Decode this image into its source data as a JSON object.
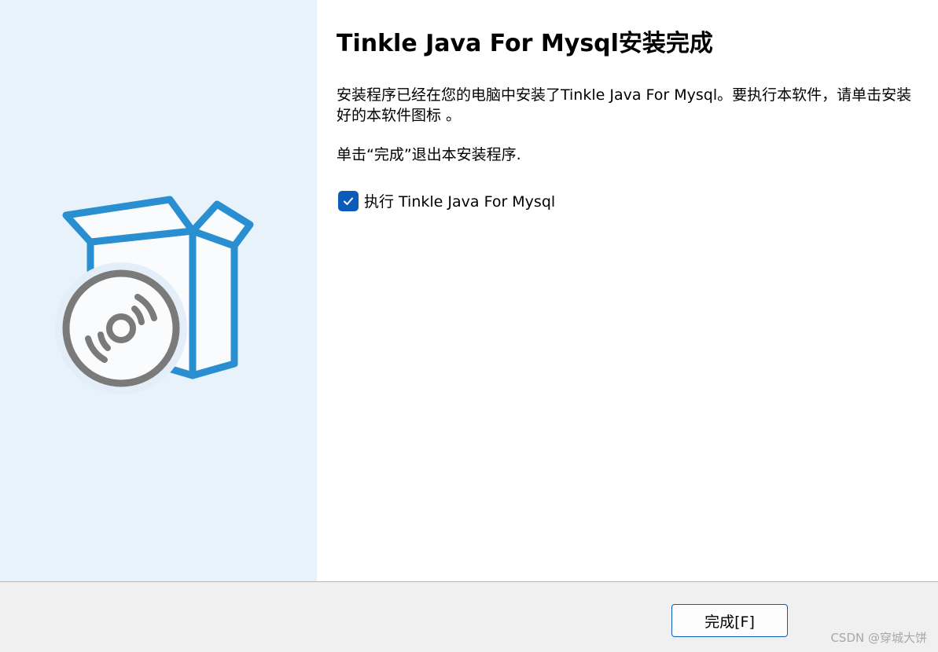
{
  "app": {
    "title": "Tinkle Java For Mysql安装完成"
  },
  "content": {
    "description": "安装程序已经在您的电脑中安装了Tinkle Java For Mysql。要执行本软件，请单击安装好的本软件图标 。",
    "exit_hint": "单击“完成”退出本安装程序.",
    "run_option": {
      "label": "执行 Tinkle Java For Mysql",
      "checked": true
    }
  },
  "footer": {
    "finish_label": "完成[F]"
  },
  "watermark": "CSDN @穿城大饼",
  "icons": {
    "illustration": "software-box-disc-icon",
    "check": "checkmark-icon"
  },
  "colors": {
    "side_panel_bg": "#e8f2fa",
    "box_blue": "#2a8fd0",
    "disc_gray": "#7a7a7a",
    "checkbox_blue": "#0a5cb8",
    "footer_bg": "#f0f0f0"
  }
}
